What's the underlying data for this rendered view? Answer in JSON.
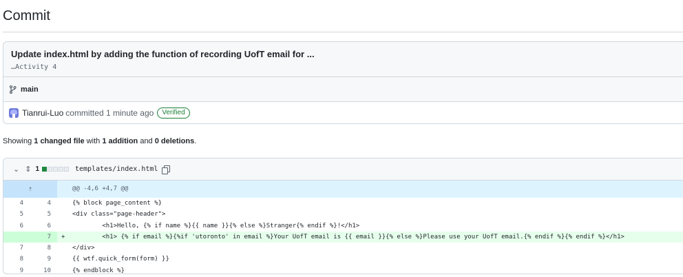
{
  "page_title": "Commit",
  "commit": {
    "message": "Update index.html by adding the function of recording UofT email for ...",
    "description": "…Activity 4",
    "branch": "main",
    "author": "Tianrui-Luo",
    "action": "committed 1 minute ago",
    "badge": "Verified"
  },
  "summary": {
    "prefix": "Showing ",
    "files": "1 changed file",
    "middle": " with ",
    "additions": "1 addition",
    "and": " and ",
    "deletions": "0 deletions",
    "suffix": "."
  },
  "file": {
    "changes": "1",
    "path": "templates/index.html",
    "hunk_header": "@@ -4,6 +4,7 @@",
    "lines": [
      {
        "old": "4",
        "new": "4",
        "sign": "",
        "code": "{% block page_content %}",
        "type": "context"
      },
      {
        "old": "5",
        "new": "5",
        "sign": "",
        "code": "<div class=\"page-header\">",
        "type": "context"
      },
      {
        "old": "6",
        "new": "6",
        "sign": "",
        "code": "        <h1>Hello, {% if name %}{{ name }}{% else %}Stranger{% endif %}!</h1>",
        "type": "context"
      },
      {
        "old": "",
        "new": "7",
        "sign": "+",
        "code": "        <h1> {% if email %}{%if 'utoronto' in email %}Your UofT email is {{ email }}{% else %}Please use your UofT email.{% endif %}{% endif %}</h1>",
        "type": "added"
      },
      {
        "old": "7",
        "new": "8",
        "sign": "",
        "code": "</div>",
        "type": "context"
      },
      {
        "old": "8",
        "new": "9",
        "sign": "",
        "code": "{{ wtf.quick_form(form) }}",
        "type": "context"
      },
      {
        "old": "9",
        "new": "10",
        "sign": "",
        "code": "{% endblock %}",
        "type": "context"
      }
    ]
  }
}
